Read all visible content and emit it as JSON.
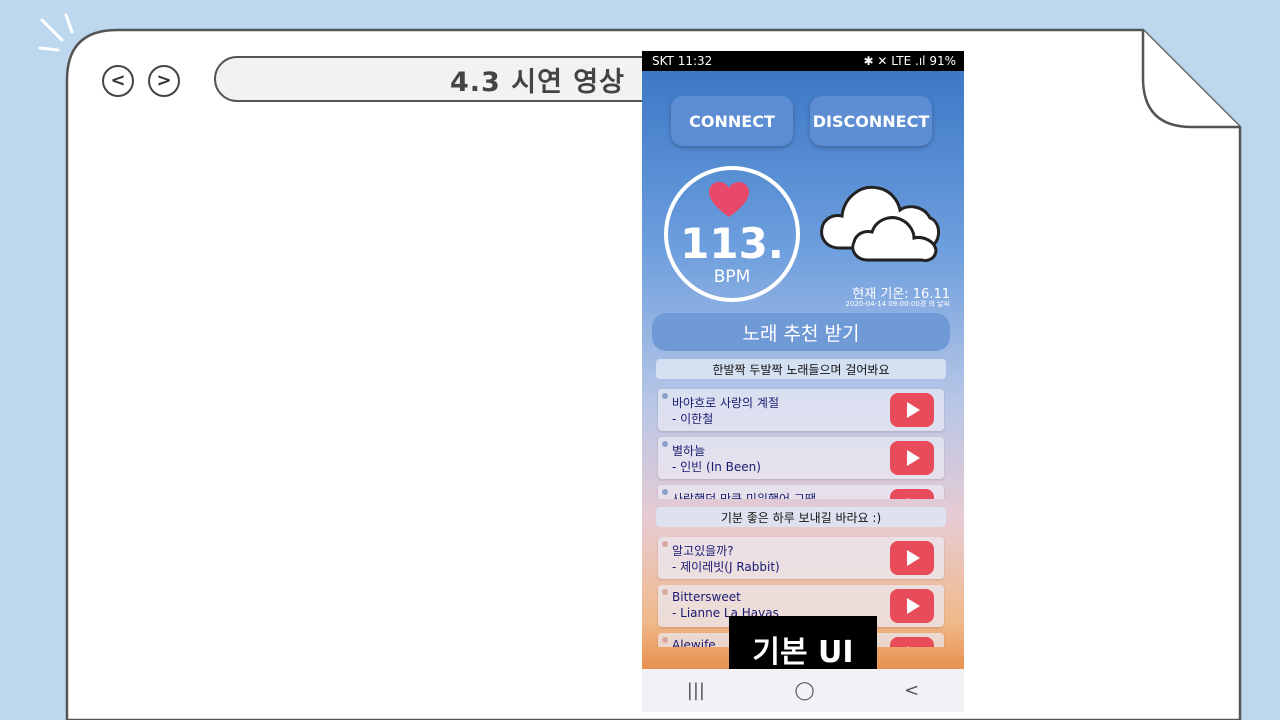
{
  "slide": {
    "title": "4.3 시연 영상",
    "prev_label": "<",
    "next_label": ">"
  },
  "phone": {
    "status": {
      "carrier_time": "SKT 11:32",
      "right": "✱ ✕ LTE .ıl 91%"
    },
    "buttons": {
      "connect": "CONNECT",
      "disconnect": "DISCONNECT"
    },
    "heart_rate": {
      "value": "113.",
      "unit": "BPM"
    },
    "weather": {
      "temp_text": "현재 기온: 16.11",
      "datetime_text": "2020-04-14 09:00:00경 의 날씨"
    },
    "recommend_label": "노래 추천 받기",
    "section1": {
      "label": "한발짝 두발짝 노래들으며 걸어봐요",
      "songs": [
        {
          "title": "바야흐로 사랑의 계절",
          "artist": "- 이한철"
        },
        {
          "title": "별하늘",
          "artist": "- 인빈 (In Been)"
        },
        {
          "title": "사랑했던 만큼 미워했어 그땐",
          "artist": ""
        }
      ]
    },
    "section2": {
      "label": "기분 좋은 하루 보내길 바라요 :)",
      "songs": [
        {
          "title": "알고있을까?",
          "artist": "- 제이레빗(J Rabbit)"
        },
        {
          "title": "Bittersweet",
          "artist": "- Lianne La Havas"
        },
        {
          "title": "Alewife",
          "artist": ""
        }
      ]
    },
    "caption": "기본 UI",
    "navbar": {
      "recent": "|||",
      "home": "◯",
      "back": "<"
    }
  },
  "colors": {
    "background": "#bdd7ee",
    "accent_red": "#e84c5a",
    "button_blue": "#5d8ed3"
  }
}
